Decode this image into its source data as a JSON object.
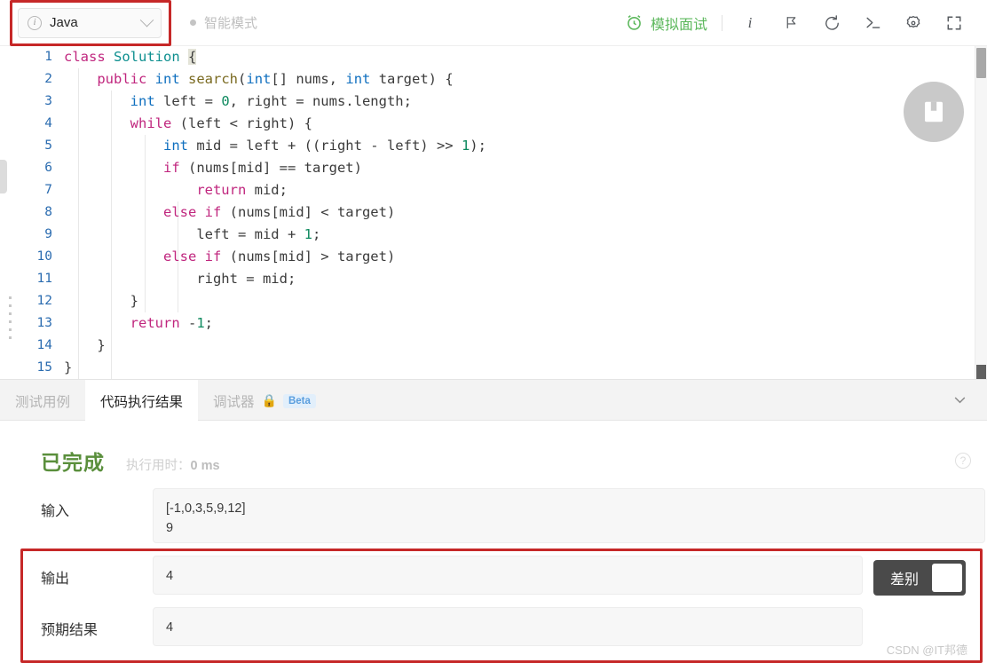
{
  "topbar": {
    "language": {
      "label": "Java",
      "icon": "info-circle-icon",
      "chevron": "chevron-down-icon"
    },
    "smart_mode": {
      "label": "智能模式",
      "indicator_color": "#c4c4c4"
    },
    "mock_interview": {
      "label": "模拟面试",
      "icon": "alarm-clock-icon",
      "color": "#5cb85c"
    },
    "icons": [
      {
        "name": "info-icon",
        "glyph": "i"
      },
      {
        "name": "flag-icon",
        "glyph": "⚐"
      },
      {
        "name": "undo-icon",
        "glyph": "↺"
      },
      {
        "name": "console-icon",
        "glyph": ">_"
      },
      {
        "name": "settings-gear-icon",
        "glyph": "✷"
      },
      {
        "name": "fullscreen-icon",
        "glyph": "⛶"
      }
    ]
  },
  "editor": {
    "note_button_icon": "notebook-bookmark-icon",
    "lines": [
      {
        "n": "1",
        "tokens": [
          {
            "t": "class ",
            "c": "kw"
          },
          {
            "t": "Solution",
            "c": "typ"
          },
          {
            "t": " ",
            "c": "pun"
          },
          {
            "t": "{",
            "c": "brace-hl"
          }
        ]
      },
      {
        "n": "2",
        "tokens": [
          {
            "t": "    ",
            "c": "pun"
          },
          {
            "t": "public",
            "c": "kw"
          },
          {
            "t": " ",
            "c": "pun"
          },
          {
            "t": "int",
            "c": "kw2"
          },
          {
            "t": " ",
            "c": "pun"
          },
          {
            "t": "search",
            "c": "fn"
          },
          {
            "t": "(",
            "c": "pun"
          },
          {
            "t": "int",
            "c": "kw2"
          },
          {
            "t": "[] nums, ",
            "c": "pun"
          },
          {
            "t": "int",
            "c": "kw2"
          },
          {
            "t": " target) {",
            "c": "pun"
          }
        ]
      },
      {
        "n": "3",
        "tokens": [
          {
            "t": "        ",
            "c": "pun"
          },
          {
            "t": "int",
            "c": "kw2"
          },
          {
            "t": " left = ",
            "c": "pun"
          },
          {
            "t": "0",
            "c": "num"
          },
          {
            "t": ", right = nums.length;",
            "c": "pun"
          }
        ]
      },
      {
        "n": "4",
        "tokens": [
          {
            "t": "        ",
            "c": "pun"
          },
          {
            "t": "while",
            "c": "kw"
          },
          {
            "t": " (left < right) {",
            "c": "pun"
          }
        ]
      },
      {
        "n": "5",
        "tokens": [
          {
            "t": "            ",
            "c": "pun"
          },
          {
            "t": "int",
            "c": "kw2"
          },
          {
            "t": " mid = left + ((right - left) >> ",
            "c": "pun"
          },
          {
            "t": "1",
            "c": "num"
          },
          {
            "t": ");",
            "c": "pun"
          }
        ]
      },
      {
        "n": "6",
        "tokens": [
          {
            "t": "            ",
            "c": "pun"
          },
          {
            "t": "if",
            "c": "kw"
          },
          {
            "t": " (nums[mid] == target)",
            "c": "pun"
          }
        ]
      },
      {
        "n": "7",
        "tokens": [
          {
            "t": "                ",
            "c": "pun"
          },
          {
            "t": "return",
            "c": "kw"
          },
          {
            "t": " mid;",
            "c": "pun"
          }
        ]
      },
      {
        "n": "8",
        "tokens": [
          {
            "t": "            ",
            "c": "pun"
          },
          {
            "t": "else",
            "c": "kw"
          },
          {
            "t": " ",
            "c": "pun"
          },
          {
            "t": "if",
            "c": "kw"
          },
          {
            "t": " (nums[mid] < target)",
            "c": "pun"
          }
        ]
      },
      {
        "n": "9",
        "tokens": [
          {
            "t": "                ",
            "c": "pun"
          },
          {
            "t": "left = mid + ",
            "c": "pun"
          },
          {
            "t": "1",
            "c": "num"
          },
          {
            "t": ";",
            "c": "pun"
          }
        ]
      },
      {
        "n": "10",
        "tokens": [
          {
            "t": "            ",
            "c": "pun"
          },
          {
            "t": "else",
            "c": "kw"
          },
          {
            "t": " ",
            "c": "pun"
          },
          {
            "t": "if",
            "c": "kw"
          },
          {
            "t": " (nums[mid] > target)",
            "c": "pun"
          }
        ]
      },
      {
        "n": "11",
        "tokens": [
          {
            "t": "                ",
            "c": "pun"
          },
          {
            "t": "right = mid;",
            "c": "pun"
          }
        ]
      },
      {
        "n": "12",
        "tokens": [
          {
            "t": "        }",
            "c": "pun"
          }
        ]
      },
      {
        "n": "13",
        "tokens": [
          {
            "t": "        ",
            "c": "pun"
          },
          {
            "t": "return",
            "c": "kw"
          },
          {
            "t": " -",
            "c": "pun"
          },
          {
            "t": "1",
            "c": "num"
          },
          {
            "t": ";",
            "c": "pun"
          }
        ]
      },
      {
        "n": "14",
        "tokens": [
          {
            "t": "    }",
            "c": "pun"
          }
        ]
      },
      {
        "n": "15",
        "tokens": [
          {
            "t": "}",
            "c": "pun"
          }
        ]
      }
    ]
  },
  "tabs": [
    {
      "label": "测试用例",
      "active": false
    },
    {
      "label": "代码执行结果",
      "active": true
    },
    {
      "label": "调试器",
      "active": false,
      "lock": "🔒",
      "badge": "Beta"
    }
  ],
  "tab_collapse_icon": "chevron-down-icon",
  "result": {
    "status": "已完成",
    "runtime_label": "执行用时：",
    "runtime_value": "0 ms",
    "help_icon": "question-circle-icon",
    "rows": [
      {
        "label": "输入",
        "value": "[-1,0,3,5,9,12]\n9"
      },
      {
        "label": "输出",
        "value": "4"
      },
      {
        "label": "预期结果",
        "value": "4"
      }
    ],
    "diff_toggle": {
      "label": "差别",
      "state": "off"
    }
  },
  "watermark": "CSDN @IT邦德",
  "colors": {
    "accent_green": "#5cb85c",
    "status_green": "#5a8f3c",
    "annotation_red": "#c62828",
    "beta_blue": "#5a9ede"
  }
}
